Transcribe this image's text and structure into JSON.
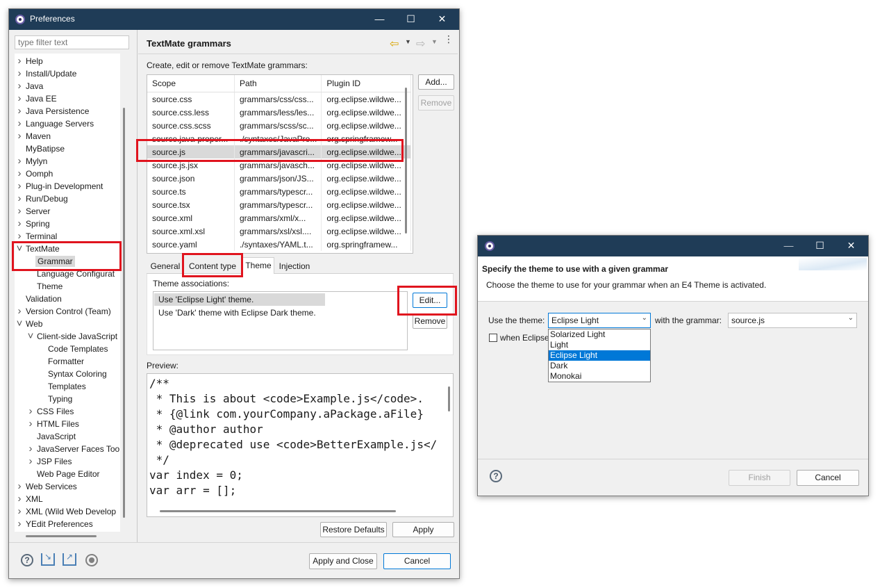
{
  "prefs": {
    "title": "Preferences",
    "filter_placeholder": "type filter text",
    "page_title": "TextMate grammars",
    "description": "Create, edit or remove TextMate grammars:",
    "columns": [
      "Scope",
      "Path",
      "Plugin ID"
    ],
    "rows": [
      [
        "source.css",
        "grammars/css/css...",
        "org.eclipse.wildwe..."
      ],
      [
        "source.css.less",
        "grammars/less/les...",
        "org.eclipse.wildwe..."
      ],
      [
        "source.css.scss",
        "grammars/scss/sc...",
        "org.eclipse.wildwe..."
      ],
      [
        "source.java-proper...",
        "./syntaxes/JavaPro...",
        "org.springframew..."
      ],
      [
        "source.js",
        "grammars/javascri...",
        "org.eclipse.wildwe..."
      ],
      [
        "source.js.jsx",
        "grammars/javasch...",
        "org.eclipse.wildwe..."
      ],
      [
        "source.json",
        "grammars/json/JS...",
        "org.eclipse.wildwe..."
      ],
      [
        "source.ts",
        "grammars/typescr...",
        "org.eclipse.wildwe..."
      ],
      [
        "source.tsx",
        "grammars/typescr...",
        "org.eclipse.wildwe..."
      ],
      [
        "source.xml",
        "grammars/xml/x...",
        "org.eclipse.wildwe..."
      ],
      [
        "source.xml.xsl",
        "grammars/xsl/xsl....",
        "org.eclipse.wildwe..."
      ],
      [
        "source.yaml",
        "./syntaxes/YAML.t...",
        "org.springframew..."
      ]
    ],
    "selected_row": 4,
    "add_label": "Add...",
    "remove_label": "Remove",
    "tabs": [
      "General",
      "Content type",
      "Theme",
      "Injection"
    ],
    "active_tab": "Theme",
    "theme_assoc_label": "Theme associations:",
    "theme_assocs": [
      "Use 'Eclipse Light' theme.",
      "Use 'Dark' theme with Eclipse Dark theme."
    ],
    "edit_label": "Edit...",
    "remove2_label": "Remove",
    "preview_label": "Preview:",
    "preview_lines": [
      "/**",
      " * This is about <code>Example.js</code>.",
      " * {@link com.yourCompany.aPackage.aFile}",
      " * @author author",
      " * @deprecated use <code>BetterExample.js</",
      " */",
      "var index = 0;",
      "var arr = [];"
    ],
    "restore_defaults": "Restore Defaults",
    "apply": "Apply",
    "apply_close": "Apply and Close",
    "cancel": "Cancel",
    "tree": [
      {
        "label": "Help",
        "level": 0,
        "chevron": ">"
      },
      {
        "label": "Install/Update",
        "level": 0,
        "chevron": ">"
      },
      {
        "label": "Java",
        "level": 0,
        "chevron": ">"
      },
      {
        "label": "Java EE",
        "level": 0,
        "chevron": ">"
      },
      {
        "label": "Java Persistence",
        "level": 0,
        "chevron": ">"
      },
      {
        "label": "Language Servers",
        "level": 0,
        "chevron": ">"
      },
      {
        "label": "Maven",
        "level": 0,
        "chevron": ">"
      },
      {
        "label": "MyBatipse",
        "level": 0,
        "chevron": ""
      },
      {
        "label": "Mylyn",
        "level": 0,
        "chevron": ">"
      },
      {
        "label": "Oomph",
        "level": 0,
        "chevron": ">"
      },
      {
        "label": "Plug-in Development",
        "level": 0,
        "chevron": ">"
      },
      {
        "label": "Run/Debug",
        "level": 0,
        "chevron": ">"
      },
      {
        "label": "Server",
        "level": 0,
        "chevron": ">"
      },
      {
        "label": "Spring",
        "level": 0,
        "chevron": ">"
      },
      {
        "label": "Terminal",
        "level": 0,
        "chevron": ">"
      },
      {
        "label": "TextMate",
        "level": 0,
        "chevron": "v"
      },
      {
        "label": "Grammar",
        "level": 1,
        "chevron": "",
        "selected": true
      },
      {
        "label": "Language Configurat",
        "level": 1,
        "chevron": ""
      },
      {
        "label": "Theme",
        "level": 1,
        "chevron": ""
      },
      {
        "label": "Validation",
        "level": 0,
        "chevron": ""
      },
      {
        "label": "Version Control (Team)",
        "level": 0,
        "chevron": ">"
      },
      {
        "label": "Web",
        "level": 0,
        "chevron": "v"
      },
      {
        "label": "Client-side JavaScript",
        "level": 1,
        "chevron": "v"
      },
      {
        "label": "Code Templates",
        "level": 2,
        "chevron": ""
      },
      {
        "label": "Formatter",
        "level": 2,
        "chevron": ""
      },
      {
        "label": "Syntax Coloring",
        "level": 2,
        "chevron": ""
      },
      {
        "label": "Templates",
        "level": 2,
        "chevron": ""
      },
      {
        "label": "Typing",
        "level": 2,
        "chevron": ""
      },
      {
        "label": "CSS Files",
        "level": 1,
        "chevron": ">"
      },
      {
        "label": "HTML Files",
        "level": 1,
        "chevron": ">"
      },
      {
        "label": "JavaScript",
        "level": 1,
        "chevron": ""
      },
      {
        "label": "JavaServer Faces Too",
        "level": 1,
        "chevron": ">"
      },
      {
        "label": "JSP Files",
        "level": 1,
        "chevron": ">"
      },
      {
        "label": "Web Page Editor",
        "level": 1,
        "chevron": ""
      },
      {
        "label": "Web Services",
        "level": 0,
        "chevron": ">"
      },
      {
        "label": "XML",
        "level": 0,
        "chevron": ">"
      },
      {
        "label": "XML (Wild Web Develop",
        "level": 0,
        "chevron": ">"
      },
      {
        "label": "YEdit Preferences",
        "level": 0,
        "chevron": ">"
      }
    ]
  },
  "dialog": {
    "title": "",
    "heading": "Specify the theme to use with a given grammar",
    "subheading": "Choose the theme to use for your grammar when an E4 Theme is activated.",
    "use_theme_label": "Use the theme:",
    "theme_value": "Eclipse Light",
    "with_grammar_label": "with the grammar:",
    "grammar_value": "source.js",
    "checkbox_label": "when Eclipse",
    "options": [
      "Solarized Light",
      "Light",
      "Eclipse Light",
      "Dark",
      "Monokai"
    ],
    "selected_option": 2,
    "finish": "Finish",
    "cancel": "Cancel"
  },
  "colors": {
    "titlebar": "#1f3c57",
    "highlight_red": "#e0141e",
    "selection_blue": "#0078d7"
  }
}
